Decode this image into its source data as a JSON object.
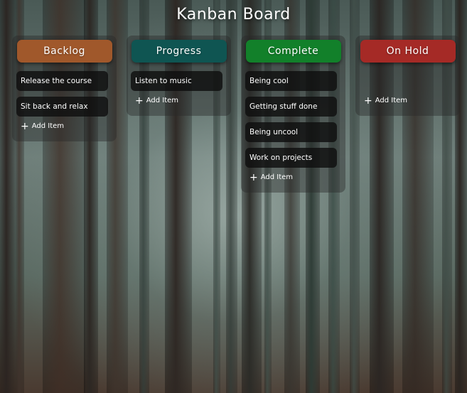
{
  "title": "Kanban Board",
  "colors": {
    "backlog": "#a0582b",
    "progress": "#0f5552",
    "complete": "#12802a",
    "on_hold": "#a52a26"
  },
  "columns": [
    {
      "name": "Backlog",
      "items": [
        "Release the course",
        "Sit back and relax"
      ],
      "add_label": "Add Item"
    },
    {
      "name": "Progress",
      "items": [
        "Listen to music"
      ],
      "add_label": "Add Item"
    },
    {
      "name": "Complete",
      "items": [
        "Being cool",
        "Getting stuff done",
        "Being uncool",
        "Work on projects"
      ],
      "add_label": "Add Item"
    },
    {
      "name": "On Hold",
      "items": [],
      "add_label": "Add Item"
    }
  ],
  "icons": {
    "add": "plus-icon"
  }
}
